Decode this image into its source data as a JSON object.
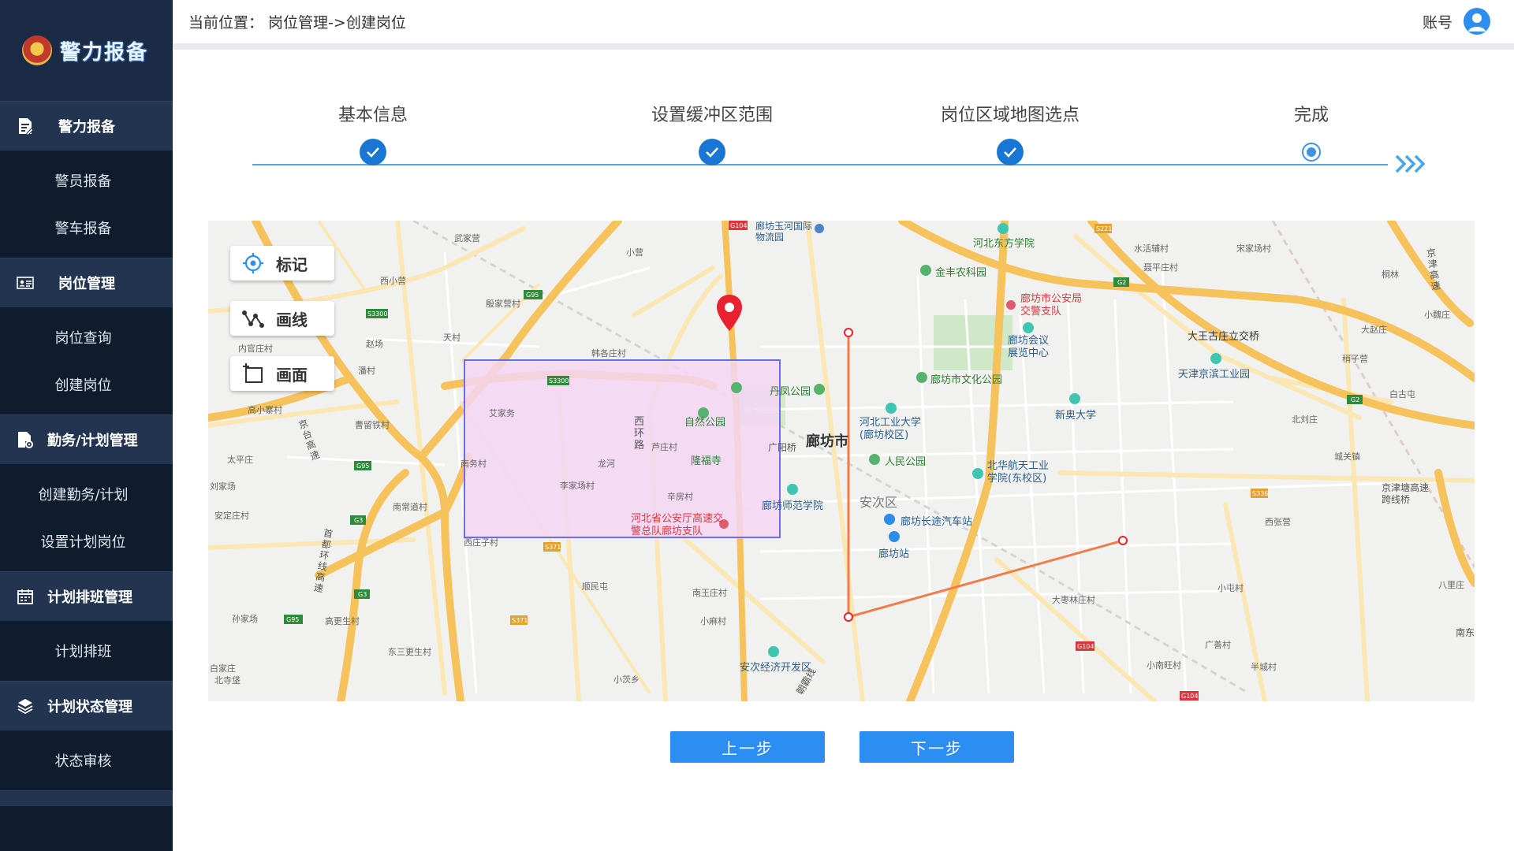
{
  "app": {
    "logo_text": "警力报备"
  },
  "sidebar": {
    "groups": [
      {
        "label": "警力报备",
        "icon": "file-edit-icon",
        "items": [
          "警员报备",
          "警车报备"
        ]
      },
      {
        "label": "岗位管理",
        "icon": "id-card-icon",
        "items": [
          "岗位查询",
          "创建岗位"
        ]
      },
      {
        "label": "勤务/计划管理",
        "icon": "file-gear-icon",
        "items": [
          "创建勤务/计划",
          "设置计划岗位"
        ]
      },
      {
        "label": "计划排班管理",
        "icon": "calendar-icon",
        "items": [
          "计划排班"
        ]
      },
      {
        "label": "计划状态管理",
        "icon": "layers-icon",
        "items": [
          "状态审核"
        ]
      }
    ]
  },
  "header": {
    "breadcrumb": "当前位置： 岗位管理->创建岗位",
    "account_label": "账号"
  },
  "steps": {
    "items": [
      {
        "label": "基本信息",
        "status": "done"
      },
      {
        "label": "设置缓冲区范围",
        "status": "done"
      },
      {
        "label": "岗位区域地图选点",
        "status": "done"
      },
      {
        "label": "完成",
        "status": "current"
      }
    ],
    "colors": {
      "done": "#1976d2",
      "track": "#54a3e8"
    }
  },
  "map": {
    "tools": {
      "mark": "标记",
      "line": "画线",
      "area": "画面"
    },
    "labels": {
      "langfang_city": "廊坊市",
      "anci_district": "安次区",
      "hebei_police": "河北省公安厅高速交警总队廊坊支队",
      "langfang_police": "廊坊市公安局交警支队",
      "ziran_park": "自然公园",
      "longfu_temple": "隆福寺",
      "danfeng_park": "丹凤公园",
      "renmin_park": "人民公园",
      "wenhua_park": "廊坊市文化公园",
      "jinfeng_park": "金丰农科园",
      "hebei_dongfang": "河北东方学院",
      "hebei_industry": "河北工业大学(廊坊校区)",
      "xinao": "新奥大学",
      "beihua": "北华航天工业学院(东校区)",
      "shifan": "廊坊师范学院",
      "bus_station": "廊坊长途汽车站",
      "langfang_station": "廊坊站",
      "expo": "廊坊会议展览中心",
      "tianjin_park": "天津京滨工业园",
      "dawangu": "大王古庄立交桥",
      "anci_dev": "安次经济开发区",
      "logistics": "廊坊玉河国际物流园",
      "guangyang_bridge": "广阳桥",
      "xihuan_road": "西环路",
      "jingtang": "京津塘高速跨线桥",
      "nandong": "南东",
      "jingjin_exp": "京津高速",
      "shoudu_ring": "首都环线高速",
      "jinggang": "京台高速",
      "chaohai": "朝霸线"
    },
    "villages": [
      "武家营",
      "小营",
      "西小营",
      "殷家营村",
      "天村",
      "赵场",
      "内官庄村",
      "潘村",
      "高小寨村",
      "曹留铁村",
      "太平庄",
      "刘家场",
      "安定庄村",
      "南常道村",
      "孙家场",
      "高更生村",
      "东三更生村",
      "白家庄",
      "北寺垡",
      "韩各庄村",
      "艾家务",
      "芦庄村",
      "龙河",
      "南务村",
      "李家场村",
      "辛房村",
      "西庄子村",
      "顺民屯",
      "南王庄村",
      "小麻村",
      "小茨乡",
      "水活辅村",
      "宋家场村",
      "聂平庄村",
      "桐林",
      "小魏庄",
      "大赵庄",
      "稍子营",
      "白古屯",
      "北刘庄",
      "城关镇",
      "西张营",
      "小屯村",
      "大枣林庄村",
      "广善村",
      "小南旺村",
      "半城村",
      "八里庄"
    ],
    "roads": [
      "G95",
      "S3300",
      "G3",
      "G104",
      "G2",
      "S221",
      "X536",
      "S371",
      "X523",
      "X532",
      "X525",
      "S336"
    ],
    "colors": {
      "polygon_fill": "#f4d6f3",
      "polygon_stroke": "#6a6ee8",
      "polyline": "#f07c4a",
      "marker": "#e8222e",
      "highway": "#f5c25c",
      "road": "#fbe7b4"
    }
  },
  "buttons": {
    "prev": "上一步",
    "next": "下一步"
  }
}
